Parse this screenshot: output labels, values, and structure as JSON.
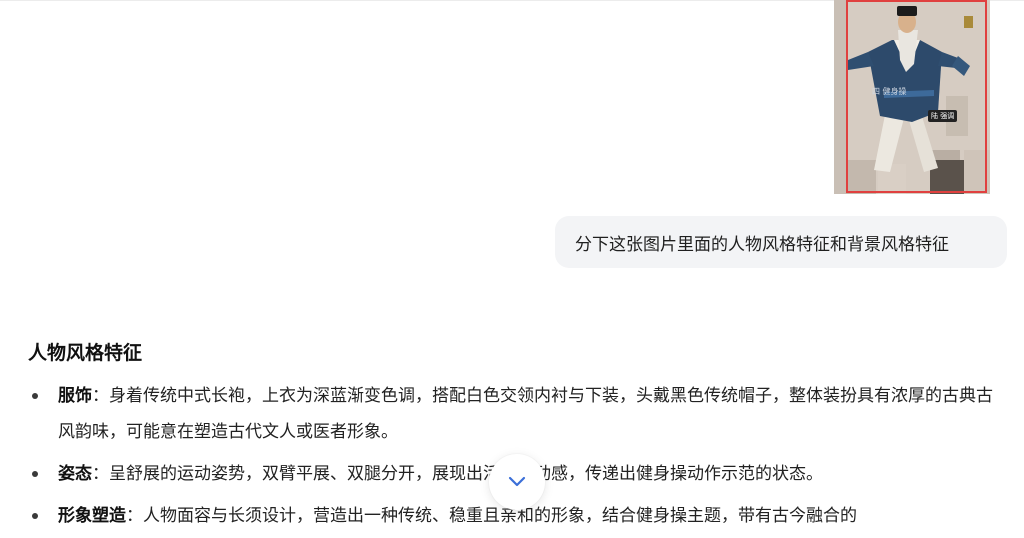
{
  "conversation": {
    "user_message": {
      "text": "分下这张图片里面的人物风格特征和背景风格特征",
      "image_labels": [
        "四 健身操",
        "陆 强调"
      ]
    },
    "response": {
      "heading": "人物风格特征",
      "items": [
        {
          "label": "服饰",
          "text": "：身着传统中式长袍，上衣为深蓝渐变色调，搭配白色交领内衬与下装，头戴黑色传统帽子，整体装扮具有浓厚的古典古风韵味，可能意在塑造古代文人或医者形象。"
        },
        {
          "label": "姿态",
          "text": "：呈舒展的运动姿势，双臂平展、双腿分开，展现出活力与动感，传递出健身操动作示范的状态。"
        },
        {
          "label": "形象塑造",
          "text": "：人物面容与长须设计，营造出一种传统、稳重且亲和的形象，结合健身操主题，带有古今融合的"
        }
      ]
    }
  },
  "controls": {
    "scroll_down_icon": "chevron-down-icon"
  },
  "colors": {
    "highlight_frame": "#e0403f",
    "bubble_bg": "#f3f4f6",
    "chevron": "#3b6fd8"
  }
}
